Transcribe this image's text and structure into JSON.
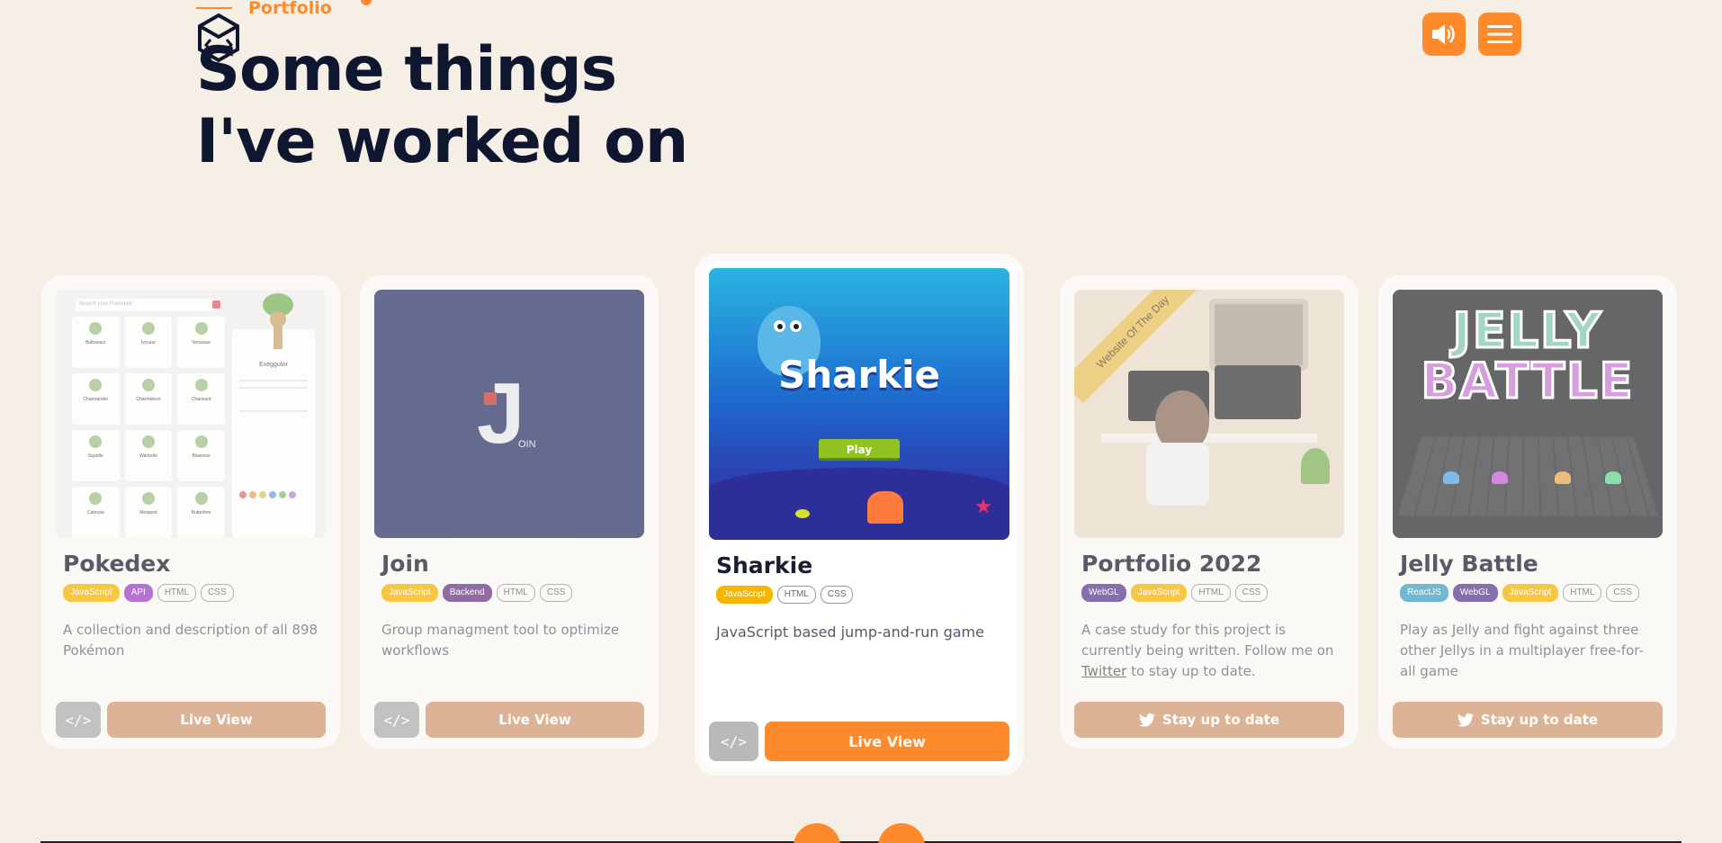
{
  "header": {
    "eyebrow": "Portfolio",
    "headline_line1": "Some things",
    "headline_line2": "I've worked on",
    "sound_icon": "speaker-icon",
    "menu_icon": "hamburger-icon"
  },
  "colors": {
    "accent": "#ff8a2b",
    "background": "#f6efe5",
    "heading": "#0f1630"
  },
  "projects": [
    {
      "title": "Pokedex",
      "tags": [
        "JavaScript",
        "API",
        "HTML",
        "CSS"
      ],
      "description": "A collection and description of all 898 Pokémon",
      "code_label": "</>",
      "action_label": "Live View",
      "image": {
        "search_placeholder": "Search your Pokemon",
        "featured": "Exeggutor",
        "names": [
          "Bulbasaur",
          "Ivysaur",
          "Venusaur",
          "Charmander",
          "Charmeleon",
          "Charizard",
          "Squirtle",
          "Wartortle",
          "Blastoise",
          "Caterpie",
          "Metapod",
          "Butterfree"
        ]
      }
    },
    {
      "title": "Join",
      "tags": [
        "JavaScript",
        "Backend",
        "HTML",
        "CSS"
      ],
      "description": "Group managment tool to optimize workflows",
      "code_label": "</>",
      "action_label": "Live View",
      "image": {
        "letter": "J",
        "word": "OIN"
      }
    },
    {
      "title": "Sharkie",
      "tags": [
        "JavaScript",
        "HTML",
        "CSS"
      ],
      "description": "JavaScript based jump-and-run game",
      "code_label": "</>",
      "action_label": "Live View",
      "image": {
        "game_title": "Sharkie",
        "play_label": "Play"
      }
    },
    {
      "title": "Portfolio 2022",
      "tags": [
        "WebGL",
        "JavaScript",
        "HTML",
        "CSS"
      ],
      "description_before": "A case study for this project is currently being written. Follow me on",
      "description_link": "Twitter",
      "description_after": "to stay up to date.",
      "action_label": "Stay up to date",
      "action_icon": "twitter-icon",
      "image": {
        "ribbon": "Website Of The Day"
      }
    },
    {
      "title": "Jelly Battle",
      "tags": [
        "ReactJS",
        "WebGL",
        "JavaScript",
        "HTML",
        "CSS"
      ],
      "description": "Play as Jelly and fight against three other Jellys in a multiplayer free-for-all game",
      "action_label": "Stay up to date",
      "action_icon": "twitter-icon",
      "image": {
        "line1": "JELLY",
        "line2": "BATTLE"
      }
    }
  ]
}
